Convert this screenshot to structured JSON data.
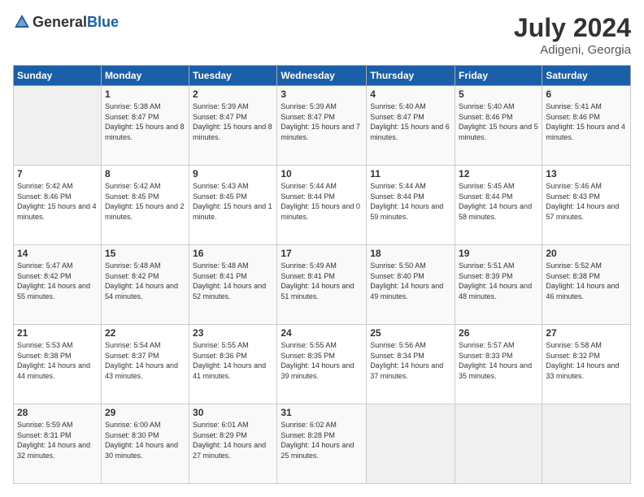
{
  "header": {
    "logo_general": "General",
    "logo_blue": "Blue",
    "month_year": "July 2024",
    "location": "Adigeni, Georgia"
  },
  "weekdays": [
    "Sunday",
    "Monday",
    "Tuesday",
    "Wednesday",
    "Thursday",
    "Friday",
    "Saturday"
  ],
  "weeks": [
    [
      {
        "day": "",
        "sunrise": "",
        "sunset": "",
        "daylight": ""
      },
      {
        "day": "1",
        "sunrise": "Sunrise: 5:38 AM",
        "sunset": "Sunset: 8:47 PM",
        "daylight": "Daylight: 15 hours and 8 minutes."
      },
      {
        "day": "2",
        "sunrise": "Sunrise: 5:39 AM",
        "sunset": "Sunset: 8:47 PM",
        "daylight": "Daylight: 15 hours and 8 minutes."
      },
      {
        "day": "3",
        "sunrise": "Sunrise: 5:39 AM",
        "sunset": "Sunset: 8:47 PM",
        "daylight": "Daylight: 15 hours and 7 minutes."
      },
      {
        "day": "4",
        "sunrise": "Sunrise: 5:40 AM",
        "sunset": "Sunset: 8:47 PM",
        "daylight": "Daylight: 15 hours and 6 minutes."
      },
      {
        "day": "5",
        "sunrise": "Sunrise: 5:40 AM",
        "sunset": "Sunset: 8:46 PM",
        "daylight": "Daylight: 15 hours and 5 minutes."
      },
      {
        "day": "6",
        "sunrise": "Sunrise: 5:41 AM",
        "sunset": "Sunset: 8:46 PM",
        "daylight": "Daylight: 15 hours and 4 minutes."
      }
    ],
    [
      {
        "day": "7",
        "sunrise": "Sunrise: 5:42 AM",
        "sunset": "Sunset: 8:46 PM",
        "daylight": "Daylight: 15 hours and 4 minutes."
      },
      {
        "day": "8",
        "sunrise": "Sunrise: 5:42 AM",
        "sunset": "Sunset: 8:45 PM",
        "daylight": "Daylight: 15 hours and 2 minutes."
      },
      {
        "day": "9",
        "sunrise": "Sunrise: 5:43 AM",
        "sunset": "Sunset: 8:45 PM",
        "daylight": "Daylight: 15 hours and 1 minute."
      },
      {
        "day": "10",
        "sunrise": "Sunrise: 5:44 AM",
        "sunset": "Sunset: 8:44 PM",
        "daylight": "Daylight: 15 hours and 0 minutes."
      },
      {
        "day": "11",
        "sunrise": "Sunrise: 5:44 AM",
        "sunset": "Sunset: 8:44 PM",
        "daylight": "Daylight: 14 hours and 59 minutes."
      },
      {
        "day": "12",
        "sunrise": "Sunrise: 5:45 AM",
        "sunset": "Sunset: 8:44 PM",
        "daylight": "Daylight: 14 hours and 58 minutes."
      },
      {
        "day": "13",
        "sunrise": "Sunrise: 5:46 AM",
        "sunset": "Sunset: 8:43 PM",
        "daylight": "Daylight: 14 hours and 57 minutes."
      }
    ],
    [
      {
        "day": "14",
        "sunrise": "Sunrise: 5:47 AM",
        "sunset": "Sunset: 8:42 PM",
        "daylight": "Daylight: 14 hours and 55 minutes."
      },
      {
        "day": "15",
        "sunrise": "Sunrise: 5:48 AM",
        "sunset": "Sunset: 8:42 PM",
        "daylight": "Daylight: 14 hours and 54 minutes."
      },
      {
        "day": "16",
        "sunrise": "Sunrise: 5:48 AM",
        "sunset": "Sunset: 8:41 PM",
        "daylight": "Daylight: 14 hours and 52 minutes."
      },
      {
        "day": "17",
        "sunrise": "Sunrise: 5:49 AM",
        "sunset": "Sunset: 8:41 PM",
        "daylight": "Daylight: 14 hours and 51 minutes."
      },
      {
        "day": "18",
        "sunrise": "Sunrise: 5:50 AM",
        "sunset": "Sunset: 8:40 PM",
        "daylight": "Daylight: 14 hours and 49 minutes."
      },
      {
        "day": "19",
        "sunrise": "Sunrise: 5:51 AM",
        "sunset": "Sunset: 8:39 PM",
        "daylight": "Daylight: 14 hours and 48 minutes."
      },
      {
        "day": "20",
        "sunrise": "Sunrise: 5:52 AM",
        "sunset": "Sunset: 8:38 PM",
        "daylight": "Daylight: 14 hours and 46 minutes."
      }
    ],
    [
      {
        "day": "21",
        "sunrise": "Sunrise: 5:53 AM",
        "sunset": "Sunset: 8:38 PM",
        "daylight": "Daylight: 14 hours and 44 minutes."
      },
      {
        "day": "22",
        "sunrise": "Sunrise: 5:54 AM",
        "sunset": "Sunset: 8:37 PM",
        "daylight": "Daylight: 14 hours and 43 minutes."
      },
      {
        "day": "23",
        "sunrise": "Sunrise: 5:55 AM",
        "sunset": "Sunset: 8:36 PM",
        "daylight": "Daylight: 14 hours and 41 minutes."
      },
      {
        "day": "24",
        "sunrise": "Sunrise: 5:55 AM",
        "sunset": "Sunset: 8:35 PM",
        "daylight": "Daylight: 14 hours and 39 minutes."
      },
      {
        "day": "25",
        "sunrise": "Sunrise: 5:56 AM",
        "sunset": "Sunset: 8:34 PM",
        "daylight": "Daylight: 14 hours and 37 minutes."
      },
      {
        "day": "26",
        "sunrise": "Sunrise: 5:57 AM",
        "sunset": "Sunset: 8:33 PM",
        "daylight": "Daylight: 14 hours and 35 minutes."
      },
      {
        "day": "27",
        "sunrise": "Sunrise: 5:58 AM",
        "sunset": "Sunset: 8:32 PM",
        "daylight": "Daylight: 14 hours and 33 minutes."
      }
    ],
    [
      {
        "day": "28",
        "sunrise": "Sunrise: 5:59 AM",
        "sunset": "Sunset: 8:31 PM",
        "daylight": "Daylight: 14 hours and 32 minutes."
      },
      {
        "day": "29",
        "sunrise": "Sunrise: 6:00 AM",
        "sunset": "Sunset: 8:30 PM",
        "daylight": "Daylight: 14 hours and 30 minutes."
      },
      {
        "day": "30",
        "sunrise": "Sunrise: 6:01 AM",
        "sunset": "Sunset: 8:29 PM",
        "daylight": "Daylight: 14 hours and 27 minutes."
      },
      {
        "day": "31",
        "sunrise": "Sunrise: 6:02 AM",
        "sunset": "Sunset: 8:28 PM",
        "daylight": "Daylight: 14 hours and 25 minutes."
      },
      {
        "day": "",
        "sunrise": "",
        "sunset": "",
        "daylight": ""
      },
      {
        "day": "",
        "sunrise": "",
        "sunset": "",
        "daylight": ""
      },
      {
        "day": "",
        "sunrise": "",
        "sunset": "",
        "daylight": ""
      }
    ]
  ]
}
